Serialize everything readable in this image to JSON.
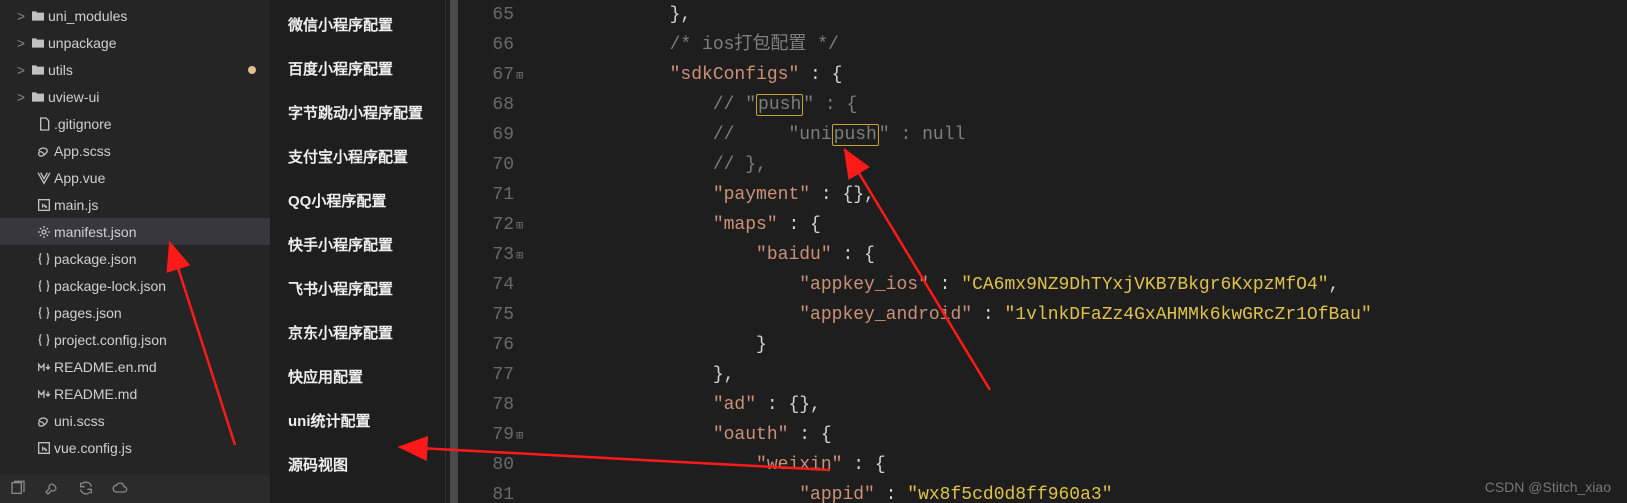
{
  "explorer": {
    "items": [
      {
        "kind": "folder",
        "chevron": ">",
        "label": "uni_modules"
      },
      {
        "kind": "folder",
        "chevron": ">",
        "label": "unpackage"
      },
      {
        "kind": "folder",
        "chevron": ">",
        "label": "utils",
        "dot": true
      },
      {
        "kind": "folder",
        "chevron": ">",
        "label": "uview-ui"
      },
      {
        "kind": "file",
        "icon": "file",
        "label": ".gitignore"
      },
      {
        "kind": "file",
        "icon": "scss",
        "label": "App.scss"
      },
      {
        "kind": "file",
        "icon": "vue",
        "label": "App.vue"
      },
      {
        "kind": "file",
        "icon": "js",
        "label": "main.js"
      },
      {
        "kind": "file",
        "icon": "json",
        "label": "manifest.json",
        "active": true
      },
      {
        "kind": "file",
        "icon": "json-b",
        "label": "package.json"
      },
      {
        "kind": "file",
        "icon": "json-b",
        "label": "package-lock.json"
      },
      {
        "kind": "file",
        "icon": "json-b",
        "label": "pages.json"
      },
      {
        "kind": "file",
        "icon": "json-b",
        "label": "project.config.json"
      },
      {
        "kind": "file",
        "icon": "md",
        "label": "README.en.md"
      },
      {
        "kind": "file",
        "icon": "md",
        "label": "README.md"
      },
      {
        "kind": "file",
        "icon": "scss",
        "label": "uni.scss"
      },
      {
        "kind": "file",
        "icon": "js",
        "label": "vue.config.js"
      }
    ],
    "footer_icons": [
      "files",
      "wrench",
      "sync",
      "cloud"
    ]
  },
  "outline": {
    "items": [
      "微信小程序配置",
      "百度小程序配置",
      "字节跳动小程序配置",
      "支付宝小程序配置",
      "QQ小程序配置",
      "快手小程序配置",
      "飞书小程序配置",
      "京东小程序配置",
      "快应用配置",
      "uni统计配置",
      "源码视图"
    ]
  },
  "editor": {
    "first_line_no": 65,
    "fold_markers": {
      "67": true,
      "72": true,
      "73": true,
      "79": true
    },
    "indent_unit": "    ",
    "lines": [
      {
        "n": 65,
        "indent": 3,
        "segs": [
          {
            "t": "},",
            "c": "punc"
          }
        ]
      },
      {
        "n": 66,
        "indent": 3,
        "segs": [
          {
            "t": "/* ios打包配置 */",
            "c": "cmt"
          }
        ]
      },
      {
        "n": 67,
        "indent": 3,
        "segs": [
          {
            "t": "\"sdkConfigs\"",
            "c": "key"
          },
          {
            "t": " : ",
            "c": "punc"
          },
          {
            "t": "{",
            "c": "punc"
          }
        ]
      },
      {
        "n": 68,
        "indent": 4,
        "segs": [
          {
            "t": "// \"",
            "c": "cmt"
          },
          {
            "t": "push",
            "c": "cmt",
            "hl": true
          },
          {
            "t": "\" : {",
            "c": "cmt"
          }
        ]
      },
      {
        "n": 69,
        "indent": 4,
        "segs": [
          {
            "t": "//     \"uni",
            "c": "cmt"
          },
          {
            "t": "push",
            "c": "cmt",
            "hl": true
          },
          {
            "t": "\" : null",
            "c": "cmt"
          }
        ]
      },
      {
        "n": 70,
        "indent": 4,
        "segs": [
          {
            "t": "// },",
            "c": "cmt"
          }
        ]
      },
      {
        "n": 71,
        "indent": 4,
        "segs": [
          {
            "t": "\"payment\"",
            "c": "key"
          },
          {
            "t": " : ",
            "c": "punc"
          },
          {
            "t": "{},",
            "c": "punc"
          }
        ]
      },
      {
        "n": 72,
        "indent": 4,
        "segs": [
          {
            "t": "\"maps\"",
            "c": "key"
          },
          {
            "t": " : ",
            "c": "punc"
          },
          {
            "t": "{",
            "c": "punc"
          }
        ]
      },
      {
        "n": 73,
        "indent": 5,
        "segs": [
          {
            "t": "\"baidu\"",
            "c": "key"
          },
          {
            "t": " : ",
            "c": "punc"
          },
          {
            "t": "{",
            "c": "punc"
          }
        ]
      },
      {
        "n": 74,
        "indent": 6,
        "segs": [
          {
            "t": "\"appkey_ios\"",
            "c": "key"
          },
          {
            "t": " : ",
            "c": "punc"
          },
          {
            "t": "\"CA6mx9NZ9DhTYxjVKB7Bkgr6KxpzMfO4\"",
            "c": "strv"
          },
          {
            "t": ",",
            "c": "punc"
          }
        ]
      },
      {
        "n": 75,
        "indent": 6,
        "segs": [
          {
            "t": "\"appkey_android\"",
            "c": "key"
          },
          {
            "t": " : ",
            "c": "punc"
          },
          {
            "t": "\"1vlnkDFaZz4GxAHMMk6kwGRcZr1OfBau\"",
            "c": "strv"
          }
        ]
      },
      {
        "n": 76,
        "indent": 5,
        "segs": [
          {
            "t": "}",
            "c": "punc"
          }
        ]
      },
      {
        "n": 77,
        "indent": 4,
        "segs": [
          {
            "t": "},",
            "c": "punc"
          }
        ]
      },
      {
        "n": 78,
        "indent": 4,
        "segs": [
          {
            "t": "\"ad\"",
            "c": "key"
          },
          {
            "t": " : ",
            "c": "punc"
          },
          {
            "t": "{},",
            "c": "punc"
          }
        ]
      },
      {
        "n": 79,
        "indent": 4,
        "segs": [
          {
            "t": "\"oauth\"",
            "c": "key"
          },
          {
            "t": " : ",
            "c": "punc"
          },
          {
            "t": "{",
            "c": "punc"
          }
        ]
      },
      {
        "n": 80,
        "indent": 5,
        "segs": [
          {
            "t": "\"weixin\"",
            "c": "key"
          },
          {
            "t": " : ",
            "c": "punc"
          },
          {
            "t": "{",
            "c": "punc"
          }
        ]
      },
      {
        "n": 81,
        "indent": 6,
        "segs": [
          {
            "t": "\"appid\"",
            "c": "key"
          },
          {
            "t": " : ",
            "c": "punc"
          },
          {
            "t": "\"wx8f5cd0d8ff960a3\"",
            "c": "strv"
          }
        ]
      }
    ]
  },
  "watermark": "CSDN @Stitch_xiao"
}
